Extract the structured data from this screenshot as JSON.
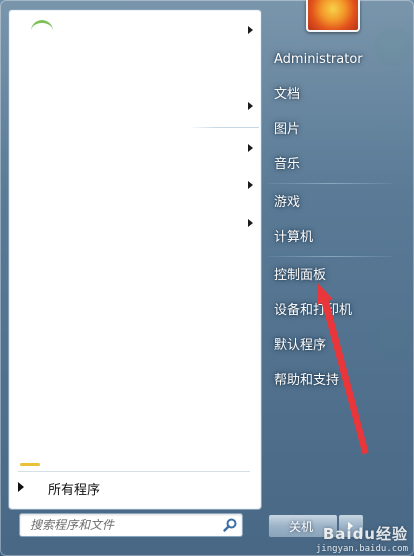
{
  "start_menu": {
    "all_programs_label": "所有程序",
    "search": {
      "placeholder": "搜索程序和文件"
    },
    "shutdown_label": "关机"
  },
  "right_pane": {
    "items": [
      {
        "label": "Administrator"
      },
      {
        "label": "文档"
      },
      {
        "label": "图片"
      },
      {
        "label": "音乐"
      },
      {
        "label": "游戏"
      },
      {
        "label": "计算机"
      },
      {
        "label": "控制面板"
      },
      {
        "label": "设备和打印机"
      },
      {
        "label": "默认程序"
      },
      {
        "label": "帮助和支持"
      }
    ]
  },
  "annotation": {
    "arrow_color": "#e8363a",
    "points_to": "控制面板"
  },
  "watermark": {
    "logo": "Baidu经验",
    "url": "jingyan.baidu.com"
  },
  "colors": {
    "accent": "#4f738f",
    "highlight_text": "#ffffff"
  },
  "icons": [
    "search-icon",
    "user-picture",
    "submenu-arrow-icon",
    "all-programs-arrow-icon",
    "shutdown-options-arrow-icon"
  ]
}
